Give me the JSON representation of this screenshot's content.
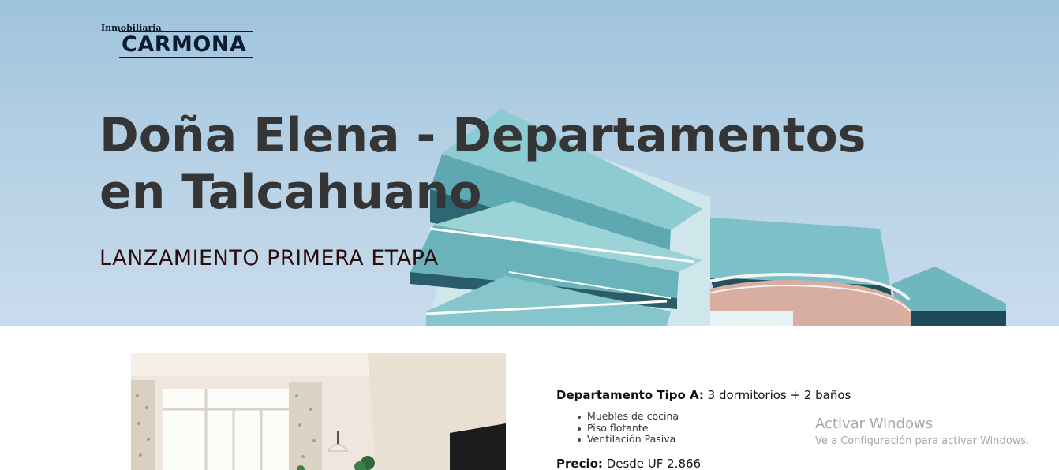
{
  "brand": {
    "small": "Inmobiliaria",
    "name": "CARMONA"
  },
  "hero": {
    "title_bold": "Doña Elena",
    "title_rest": " - Departamentos en Talcahuano",
    "subtitle": "LANZAMIENTO PRIMERA ETAPA"
  },
  "unit": {
    "type_label": "Departamento Tipo A:",
    "type_value": " 3 dormitorios + 2 baños",
    "features": [
      "Muebles de cocina",
      "Piso flotante",
      "Ventilación Pasiva"
    ],
    "price_label": "Precio:",
    "price_value": " Desde UF 2.866"
  },
  "watermark": {
    "title": "Activar Windows",
    "subtitle": "Ve a Configuración para activar Windows."
  }
}
